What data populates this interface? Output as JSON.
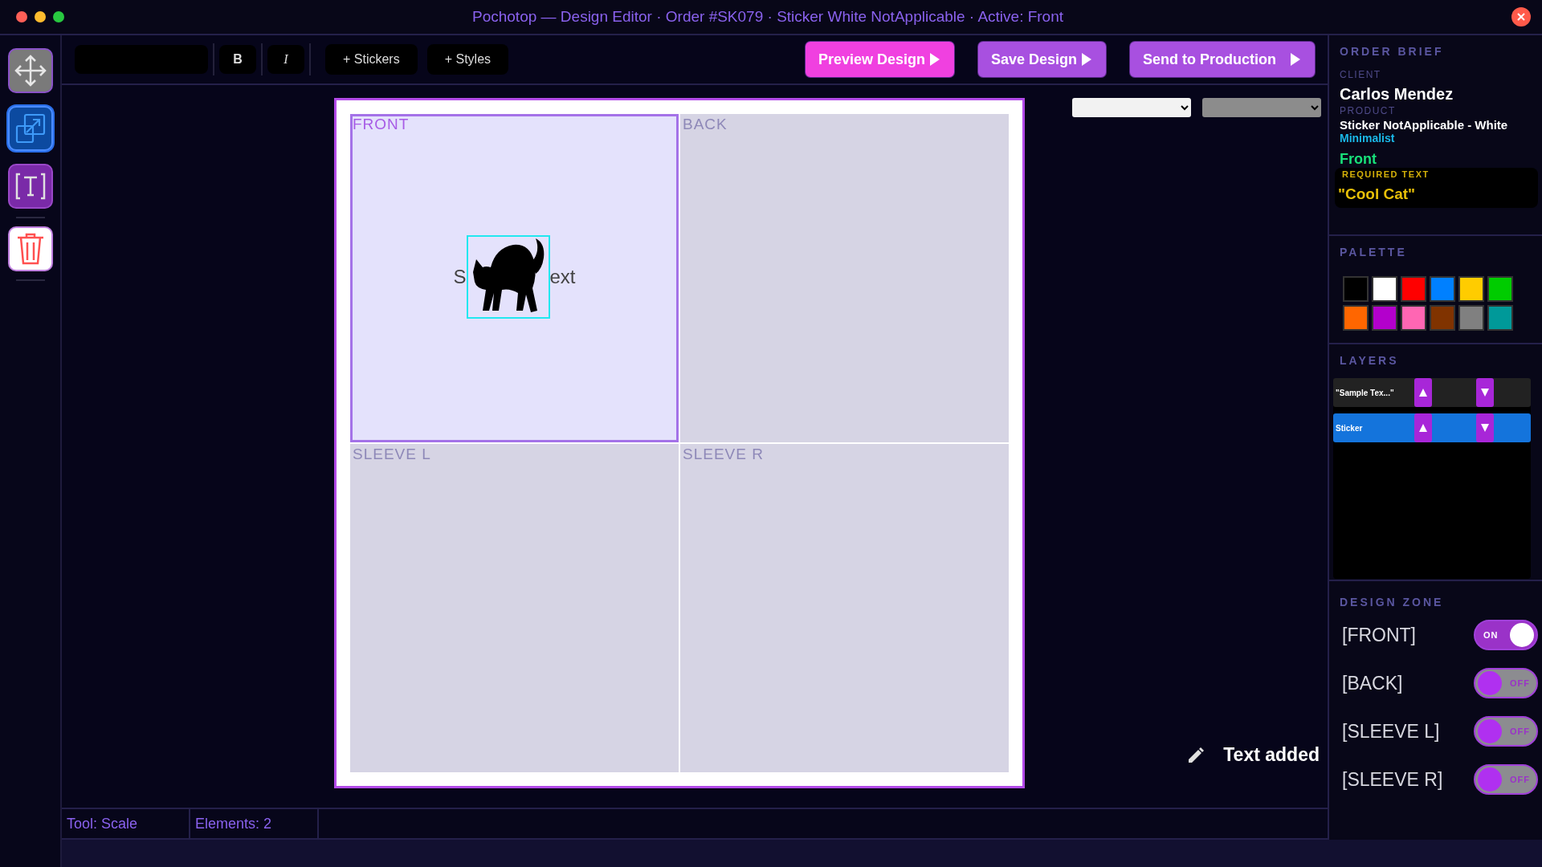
{
  "window": {
    "title": "Pochotop — Design Editor · Order #SK079 · Sticker White NotApplicable · Active: Front"
  },
  "tools": [
    {
      "kind": "move",
      "selected": false
    },
    {
      "kind": "scale",
      "selected": true
    },
    {
      "kind": "text",
      "selected": false
    },
    {
      "kind": "delete",
      "selected": false
    }
  ],
  "toolbar": {
    "format_buttons": [
      {
        "label": "B",
        "kind": "bold"
      },
      {
        "label": "I",
        "kind": "italic"
      }
    ],
    "add_buttons": [
      "+ Stickers",
      "+ Styles"
    ],
    "actions": [
      {
        "label": "Preview Design",
        "kind": "preview"
      },
      {
        "label": "Save Design",
        "kind": "save"
      },
      {
        "label": "Send to Production",
        "kind": "send"
      }
    ]
  },
  "canvas": {
    "zones": [
      {
        "label": "FRONT",
        "selected": true
      },
      {
        "label": "BACK",
        "selected": false
      },
      {
        "label": "SLEEVE L",
        "selected": false
      },
      {
        "label": "SLEEVE R",
        "selected": false
      }
    ],
    "text_parts": [
      "S",
      "ext"
    ]
  },
  "toast": "Text added",
  "order_brief": {
    "heading": "ORDER BRIEF",
    "client_label": "CLIENT",
    "client": "Carlos Mendez",
    "product_label": "PRODUCT",
    "product": "Sticker NotApplicable - White",
    "style": "Minimalist",
    "zone": "Front",
    "required_label": "REQUIRED TEXT",
    "required_text": "\"Cool Cat\""
  },
  "palette": {
    "heading": "PALETTE",
    "swatches": [
      {
        "color": "#000000"
      },
      {
        "color": "#ffffff"
      },
      {
        "color": "#ff0000"
      },
      {
        "color": "#0080ff"
      },
      {
        "color": "#ffcc00"
      },
      {
        "color": "#00cc00"
      },
      {
        "color": "#ff6600"
      },
      {
        "color": "#b300cc"
      },
      {
        "color": "#ff66b3"
      },
      {
        "color": "#803300"
      },
      {
        "color": "#808080"
      },
      {
        "color": "#009999"
      }
    ]
  },
  "layers": {
    "heading": "LAYERS",
    "items": [
      {
        "label": "\"Sample Tex...\"",
        "selected": false
      },
      {
        "label": "Sticker",
        "selected": true
      }
    ]
  },
  "design_zone": {
    "heading": "DESIGN ZONE",
    "zones": [
      {
        "label": "[FRONT]",
        "on": true,
        "state_label": "ON"
      },
      {
        "label": "[BACK]",
        "on": false,
        "state_label": "OFF"
      },
      {
        "label": "[SLEEVE L]",
        "on": false,
        "state_label": "OFF"
      },
      {
        "label": "[SLEEVE R]",
        "on": false,
        "state_label": "OFF"
      }
    ]
  },
  "status_bar": [
    "Tool: Scale",
    "Elements: 2"
  ]
}
